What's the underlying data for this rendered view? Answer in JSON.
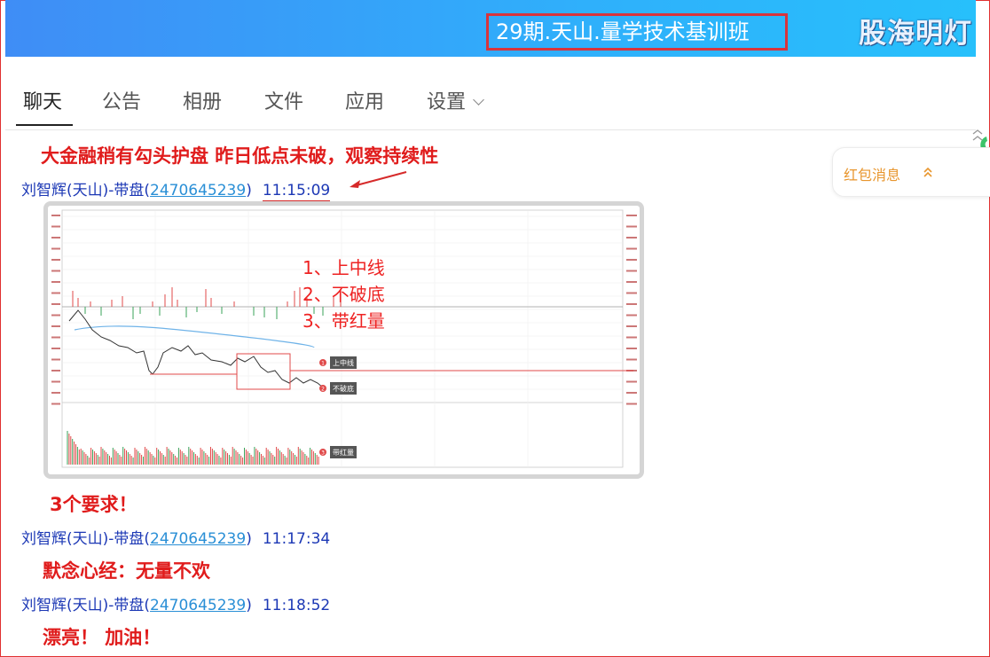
{
  "header": {
    "group_title": "29期.天山.量学技术基训班",
    "watermark": "股海明灯"
  },
  "tabs": [
    {
      "label": "聊天",
      "active": true
    },
    {
      "label": "公告"
    },
    {
      "label": "相册"
    },
    {
      "label": "文件"
    },
    {
      "label": "应用"
    },
    {
      "label": "设置"
    }
  ],
  "side_panel": {
    "label": "红包消息",
    "icon": "double-chevron-up-icon"
  },
  "messages": [
    {
      "text": "大金融稍有勾头护盘  昨日低点未破，观察持续性"
    },
    {
      "sender": "刘智辉(天山)-带盘(",
      "qq": "2470645239",
      "close": ")",
      "time": "11:15:09"
    },
    {
      "text": "3个要求！"
    },
    {
      "sender": "刘智辉(天山)-带盘(",
      "qq": "2470645239",
      "close": ")",
      "time": "11:17:34"
    },
    {
      "text": "默念心经：无量不欢"
    },
    {
      "sender": "刘智辉(天山)-带盘(",
      "qq": "2470645239",
      "close": ")",
      "time": "11:18:52"
    },
    {
      "text": "漂亮！  加油！"
    }
  ],
  "chart_image": {
    "annotations": [
      "1、上中线",
      "2、不破底",
      "3、带红量"
    ],
    "markers": [
      "上中线",
      "不破底",
      "带红量"
    ],
    "marker_numbers": [
      "1",
      "2",
      "3"
    ],
    "colors": {
      "price": "#333333",
      "avg": "#6fb3e8",
      "up": "#e04a4a",
      "down": "#3aa35a",
      "callout": "#555555",
      "frame": "#c9c9c9"
    }
  },
  "colors": {
    "header_start": "#3f8df6",
    "header_end": "#27c0fb",
    "message_red": "#e01c1c",
    "sender_blue": "#1c38b5",
    "qq_link": "#2a8fd6",
    "side_panel_orange": "#e8962e"
  }
}
